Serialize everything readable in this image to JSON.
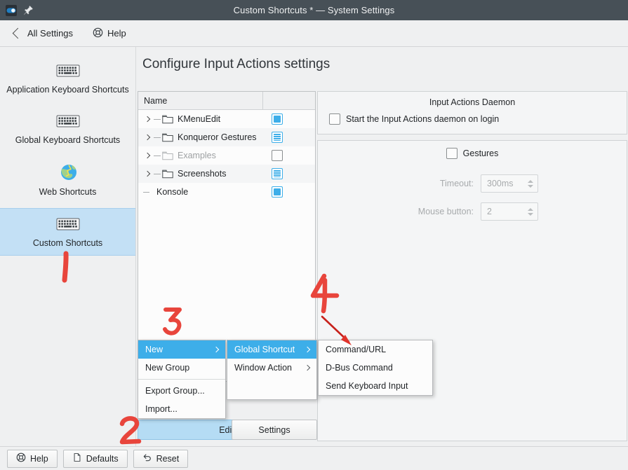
{
  "window": {
    "title": "Custom Shortcuts * — System Settings",
    "icons": [
      {
        "name": "toggle-switch-icon"
      },
      {
        "name": "pin-icon"
      }
    ]
  },
  "toolbar": {
    "back_label": "All Settings",
    "help_label": "Help",
    "back_icon": "chevron-left-icon",
    "help_icon": "lifebuoy-icon"
  },
  "sidebar": {
    "items": [
      {
        "label": "Application Keyboard Shortcuts",
        "icon": "keyboard-icon",
        "selected": false
      },
      {
        "label": "Global Keyboard Shortcuts",
        "icon": "keyboard-icon",
        "selected": false
      },
      {
        "label": "Web Shortcuts",
        "icon": "globe-icon",
        "selected": false
      },
      {
        "label": "Custom Shortcuts",
        "icon": "keyboard-icon",
        "selected": true
      }
    ]
  },
  "main": {
    "page_title": "Configure Input Actions settings",
    "tree": {
      "columns": [
        "Name",
        ""
      ],
      "rows": [
        {
          "label": "KMenuEdit",
          "expandable": true,
          "state": "checked",
          "disabled": false
        },
        {
          "label": "Konqueror Gestures",
          "expandable": true,
          "state": "partial",
          "disabled": false
        },
        {
          "label": "Examples",
          "expandable": true,
          "state": "unchecked",
          "disabled": true
        },
        {
          "label": "Screenshots",
          "expandable": true,
          "state": "partial",
          "disabled": false
        },
        {
          "label": "Konsole",
          "expandable": false,
          "state": "checked",
          "disabled": false
        }
      ]
    },
    "edit_button": {
      "label": "Edit",
      "icon": "chevron-down-icon"
    },
    "settings_button": {
      "label": "Settings"
    }
  },
  "right_panel": {
    "daemon_group": {
      "title": "Input Actions Daemon",
      "checkbox_label": "Start the Input Actions daemon on login",
      "checked": false
    },
    "gestures_group": {
      "checkbox_label": "Gestures",
      "checked": false,
      "timeout_label": "Timeout:",
      "timeout_value": "300ms",
      "mouse_button_label": "Mouse button:",
      "mouse_button_value": "2",
      "disabled": true
    }
  },
  "context_menu": {
    "primary": [
      {
        "label": "New",
        "submenu": true,
        "selected": true
      },
      {
        "label": "New Group",
        "submenu": false,
        "selected": false
      },
      {
        "label": "Export Group...",
        "submenu": false,
        "selected": false
      },
      {
        "label": "Import...",
        "submenu": false,
        "selected": false
      }
    ],
    "secondary": [
      {
        "label": "Global Shortcut",
        "submenu": true,
        "selected": true
      },
      {
        "label": "Window Action",
        "submenu": true,
        "selected": false
      }
    ],
    "tertiary": [
      {
        "label": "Command/URL",
        "submenu": false,
        "selected": false
      },
      {
        "label": "D-Bus Command",
        "submenu": false,
        "selected": false
      },
      {
        "label": "Send Keyboard Input",
        "submenu": false,
        "selected": false
      }
    ]
  },
  "bottom_bar": {
    "buttons": [
      {
        "label": "Help",
        "icon": "lifebuoy-icon"
      },
      {
        "label": "Defaults",
        "icon": "document-revert-icon"
      },
      {
        "label": "Reset",
        "icon": "undo-arrow-icon"
      }
    ]
  },
  "annotations": {
    "color": "#e8453c",
    "marks": [
      {
        "label": "1",
        "target": "custom-shortcuts-sidebar-item"
      },
      {
        "label": "2",
        "target": "edit-button"
      },
      {
        "label": "3",
        "target": "new-menu-item"
      },
      {
        "label": "4",
        "target": "command-url-menu-item"
      }
    ]
  }
}
